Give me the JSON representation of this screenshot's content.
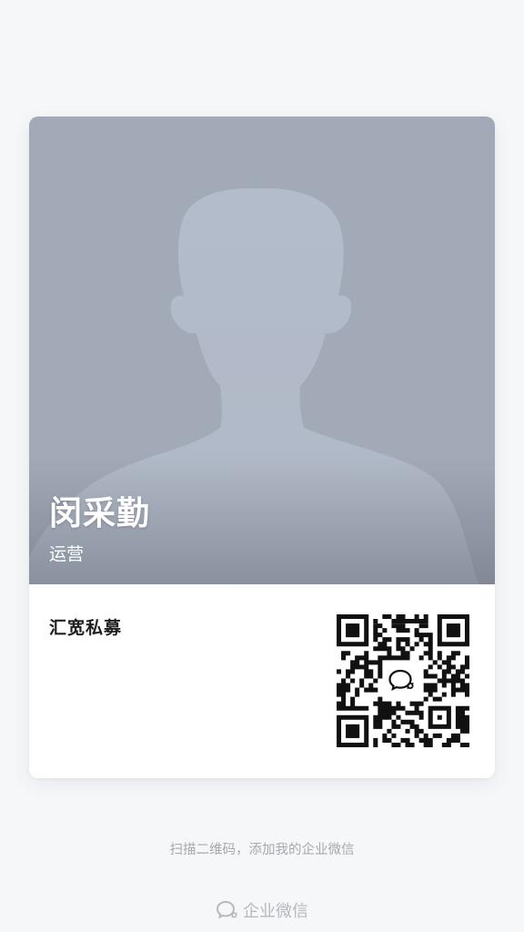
{
  "card": {
    "name": "闵采勤",
    "role": "运营",
    "company": "汇宽私募"
  },
  "footer": {
    "hint": "扫描二维码，添加我的企业微信",
    "brand": "企业微信"
  },
  "icons": {
    "avatar": "person-silhouette-icon",
    "qr_center": "wecom-logo-icon",
    "brand": "wecom-logo-icon"
  },
  "colors": {
    "page_background": "#f6f7f9",
    "photo_background": "#a2a9b7",
    "silhouette": "#b3bccb",
    "text_light": "#ffffff",
    "text_dark": "#1f1f1f",
    "text_muted": "#a5a8ae"
  }
}
